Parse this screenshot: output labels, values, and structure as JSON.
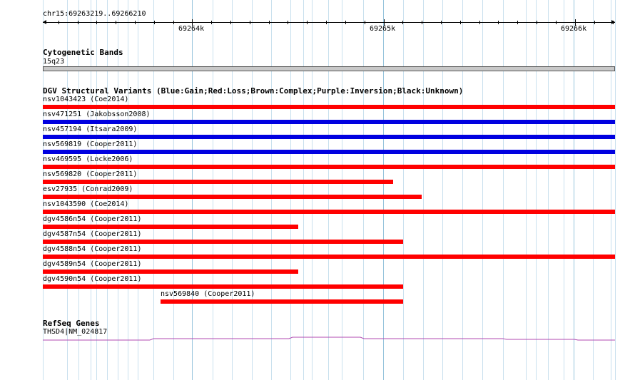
{
  "ruler": {
    "region": "chr15:69263219..69266210",
    "ticks": [
      "69264k",
      "69265k",
      "69266k"
    ]
  },
  "cytoband": {
    "title": "Cytogenetic Bands",
    "band": "15q23",
    "color": "#c8c8c8"
  },
  "dgv": {
    "title": "DGV Structural Variants (Blue:Gain;Red:Loss;Brown:Complex;Purple:Inversion;Black:Unknown)",
    "colors": {
      "loss": "#ff0000",
      "gain": "#0000e0"
    },
    "features": [
      {
        "label": "nsv1043423 (Coe2014)",
        "type": "loss",
        "start": 69263219,
        "end": 69266210
      },
      {
        "label": "nsv471251 (Jakobsson2008)",
        "type": "gain",
        "start": 69263219,
        "end": 69266210
      },
      {
        "label": "nsv457194 (Itsara2009)",
        "type": "gain",
        "start": 69263219,
        "end": 69266210
      },
      {
        "label": "nsv569819 (Cooper2011)",
        "type": "gain",
        "start": 69263219,
        "end": 69266210
      },
      {
        "label": "nsv469595 (Locke2006)",
        "type": "loss",
        "start": 69263219,
        "end": 69266210
      },
      {
        "label": "nsv569820 (Cooper2011)",
        "type": "loss",
        "start": 69263219,
        "end": 69265050
      },
      {
        "label": "esv27935 (Conrad2009)",
        "type": "loss",
        "start": 69263219,
        "end": 69265200
      },
      {
        "label": "nsv1043590 (Coe2014)",
        "type": "loss",
        "start": 69263219,
        "end": 69266210
      },
      {
        "label": "dgv4586n54 (Cooper2011)",
        "type": "loss",
        "start": 69263219,
        "end": 69264555
      },
      {
        "label": "dgv4587n54 (Cooper2011)",
        "type": "loss",
        "start": 69263219,
        "end": 69265103
      },
      {
        "label": "dgv4588n54 (Cooper2011)",
        "type": "loss",
        "start": 69263219,
        "end": 69266210
      },
      {
        "label": "dgv4589n54 (Cooper2011)",
        "type": "loss",
        "start": 69263219,
        "end": 69264555
      },
      {
        "label": "dgv4590n54 (Cooper2011)",
        "type": "loss",
        "start": 69263219,
        "end": 69265103
      },
      {
        "label": "nsv569840 (Cooper2011)",
        "type": "loss",
        "start": 69263836,
        "end": 69265103
      }
    ]
  },
  "refseq": {
    "title": "RefSeq Genes",
    "gene_label": "THSD4|NM_024817",
    "color": "#b04ab0"
  }
}
